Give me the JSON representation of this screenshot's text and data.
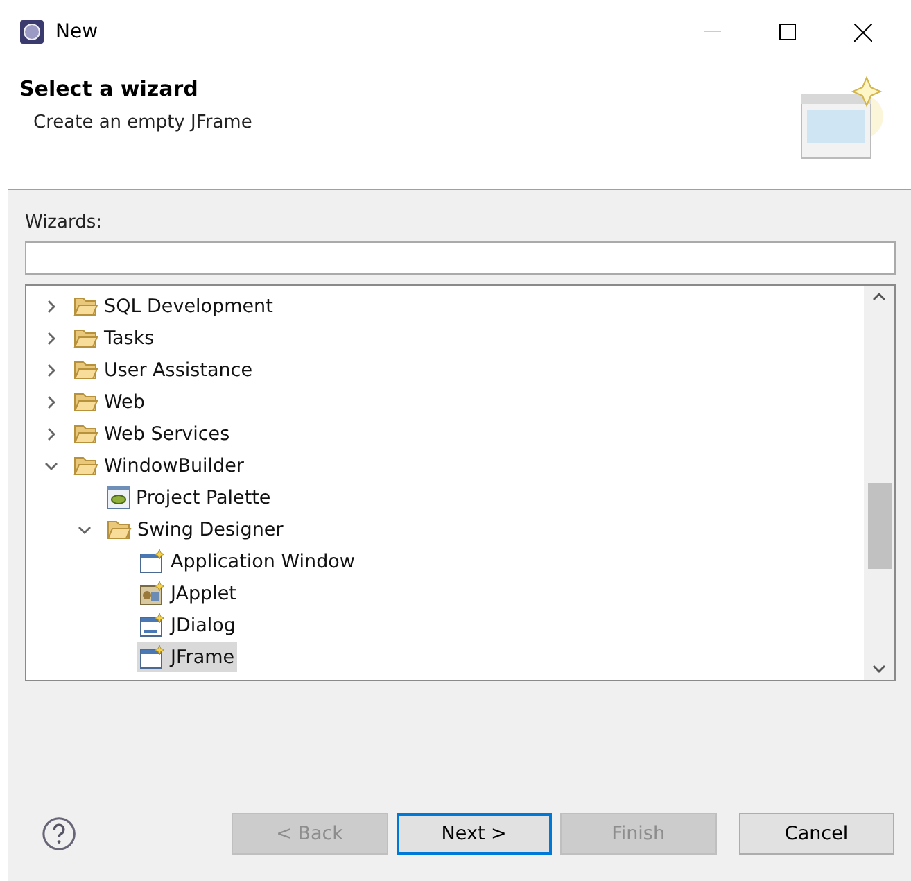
{
  "window": {
    "title": "New"
  },
  "header": {
    "title": "Select a wizard",
    "subtitle": "Create an empty JFrame"
  },
  "filter": {
    "label": "Wizards:"
  },
  "tree": [
    {
      "label": "SQL Development",
      "kind": "folder",
      "expanded": false,
      "selected": false
    },
    {
      "label": "Tasks",
      "kind": "folder",
      "expanded": false,
      "selected": false
    },
    {
      "label": "User Assistance",
      "kind": "folder",
      "expanded": false,
      "selected": false
    },
    {
      "label": "Web",
      "kind": "folder",
      "expanded": false,
      "selected": false
    },
    {
      "label": "Web Services",
      "kind": "folder",
      "expanded": false,
      "selected": false
    },
    {
      "label": "WindowBuilder",
      "kind": "folder",
      "expanded": true,
      "selected": false,
      "children": [
        {
          "label": "Project Palette",
          "kind": "palette",
          "selected": false
        },
        {
          "label": "Swing Designer",
          "kind": "folder",
          "expanded": true,
          "selected": false,
          "children": [
            {
              "label": "Application Window",
              "kind": "frame",
              "selected": false
            },
            {
              "label": "JApplet",
              "kind": "applet",
              "selected": false
            },
            {
              "label": "JDialog",
              "kind": "dialog",
              "selected": false
            },
            {
              "label": "JFrame",
              "kind": "frame",
              "selected": true
            }
          ]
        }
      ]
    }
  ],
  "buttons": [
    {
      "label": "< Back",
      "disabled": true,
      "default": false
    },
    {
      "label": "Next >",
      "disabled": false,
      "default": true
    },
    {
      "label": "Finish",
      "disabled": true,
      "default": false
    },
    {
      "label": "Cancel",
      "disabled": false,
      "default": false
    }
  ]
}
